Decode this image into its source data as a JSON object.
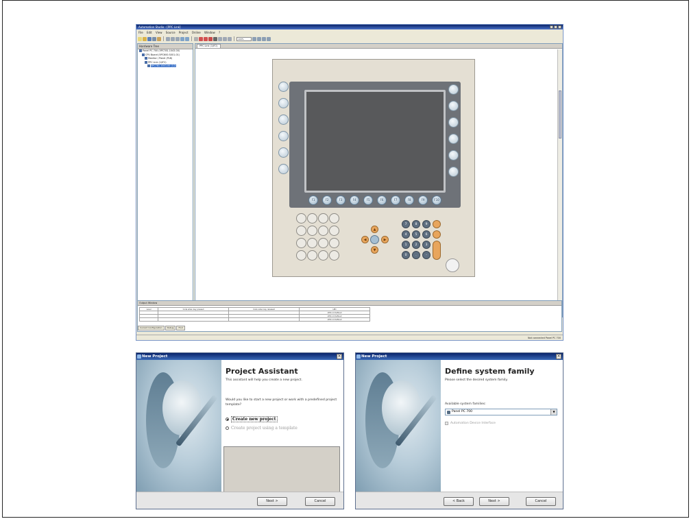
{
  "main_window": {
    "title": "Automation Studio - [PPC Link]",
    "menu": [
      "File",
      "Edit",
      "View",
      "Source",
      "Project",
      "Online",
      "Window",
      "?"
    ],
    "zoom": "100%",
    "tree": {
      "header": "Hardware Tree",
      "items": [
        "Panel PC 700 (5PC781.1043-00)",
        "CPU Board (5PC600.SX01-01)",
        "Monitor / Panel (PLB)",
        "PPC Link (1/IF2)",
        "5PC781.1043-00 (1/2)"
      ]
    },
    "doc_tab": "PPC Link (1/IF2)",
    "output": {
      "header": "Output Window",
      "columns": [
        "Level",
        "Code when key pressed",
        "Code when key released",
        "LED"
      ],
      "rows": [
        [
          "",
          "",
          "",
          "LED not defined"
        ],
        [
          "",
          "",
          "",
          "LED not defined"
        ],
        [
          "",
          "",
          "",
          "LED not defined"
        ]
      ],
      "tabs": [
        "Current Configuration",
        "Debug",
        "Find"
      ]
    },
    "status": "Not connected   Panel PC 700"
  },
  "device": {
    "fkeys": [
      "F1",
      "F2",
      "F3",
      "F4",
      "F5",
      "F6",
      "F7",
      "F8",
      "F9",
      "F10"
    ],
    "numkeys": [
      "7",
      "8",
      "9",
      "4",
      "5",
      "6",
      "1",
      "2",
      "3",
      "0",
      ".",
      "-"
    ]
  },
  "dialog1": {
    "title": "New Project",
    "heading": "Project Assistant",
    "subtitle": "This assistant will help you create a new project.",
    "question": "Would you like to start a new project or work with a predefined project template?",
    "option_new": "Create new project",
    "option_template": "Create project using a template",
    "next": "Next >",
    "cancel": "Cancel"
  },
  "dialog2": {
    "title": "New Project",
    "heading": "Define system family",
    "subtitle": "Please select the desired system family.",
    "families_label": "Available system families:",
    "selected_family": "Panel PC 700",
    "checkbox": "Automation Device Interface",
    "back": "< Back",
    "next": "Next >",
    "cancel": "Cancel"
  }
}
